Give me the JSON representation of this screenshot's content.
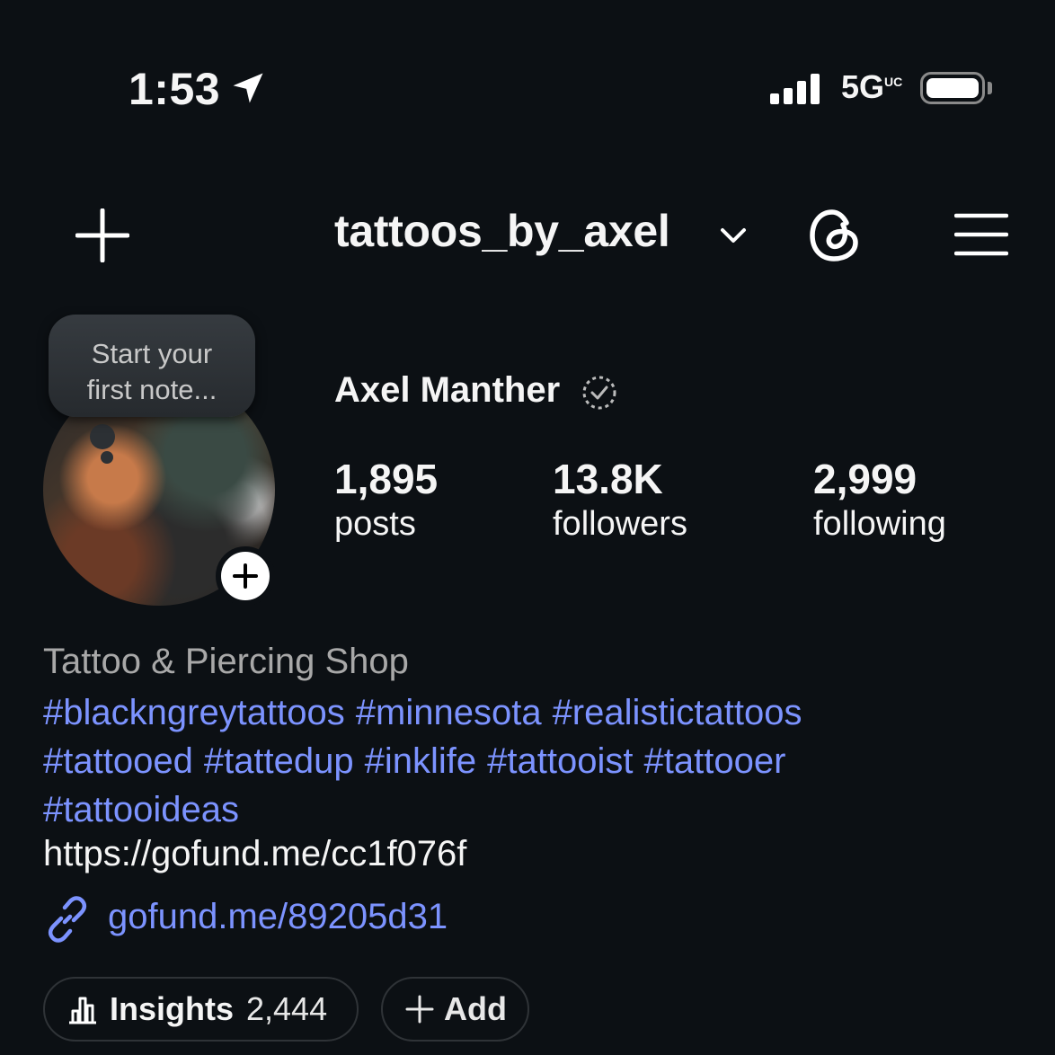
{
  "status_bar": {
    "time": "1:53",
    "network": "5G",
    "network_sup": "UC",
    "icons": [
      "location-arrow-icon",
      "signal-bars-icon",
      "battery-icon"
    ]
  },
  "header": {
    "username": "tattoos_by_axel",
    "icons": [
      "plus-icon",
      "chevron-down-icon",
      "threads-icon",
      "menu-icon"
    ]
  },
  "note": {
    "line1": "Start your",
    "line2": "first note..."
  },
  "profile": {
    "full_name": "Axel Manther",
    "stats": {
      "posts": {
        "count": "1,895",
        "label": "posts"
      },
      "followers": {
        "count": "13.8K",
        "label": "followers"
      },
      "following": {
        "count": "2,999",
        "label": "following"
      }
    }
  },
  "bio": {
    "category": "Tattoo & Piercing Shop",
    "hashtags": [
      "#blackngreytattoos",
      "#minnesota",
      "#realistictattoos",
      "#tattooed",
      "#tattedup",
      "#inklife",
      "#tattooist",
      "#tattooer",
      "#tattooideas"
    ],
    "url_text": "https://gofund.me/cc1f076f",
    "link": "gofund.me/89205d31"
  },
  "buttons": {
    "insights_label": "Insights",
    "insights_count": "2,444",
    "add_label": "Add"
  },
  "colors": {
    "background": "#0c1014",
    "link_blue": "#7c93ff",
    "secondary_text": "#a8a8a8"
  }
}
